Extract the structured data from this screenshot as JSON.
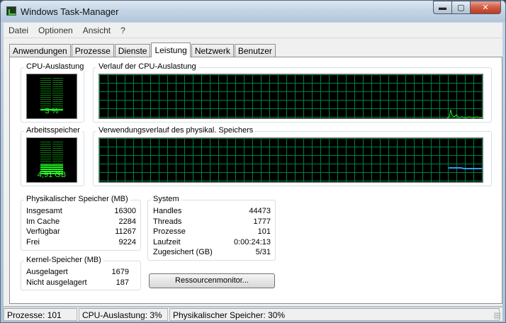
{
  "window": {
    "title": "Windows Task-Manager",
    "minimize_glyph": "▬",
    "maximize_glyph": "▢",
    "close_glyph": "✕"
  },
  "menu": [
    "Datei",
    "Optionen",
    "Ansicht",
    "?"
  ],
  "tabs": [
    {
      "label": "Anwendungen",
      "active": false
    },
    {
      "label": "Prozesse",
      "active": false
    },
    {
      "label": "Dienste",
      "active": false
    },
    {
      "label": "Leistung",
      "active": true
    },
    {
      "label": "Netzwerk",
      "active": false
    },
    {
      "label": "Benutzer",
      "active": false
    }
  ],
  "cpu_meter": {
    "label": "CPU-Auslastung",
    "value_text": "3 %",
    "level_percent": 3
  },
  "cpu_history": {
    "label": "Verlauf der CPU-Auslastung"
  },
  "memory_meter": {
    "label": "Arbeitsspeicher",
    "value_text": "4,91 GB",
    "level_percent": 30
  },
  "memory_history": {
    "label": "Verwendungsverlauf des physikal. Speichers"
  },
  "physical_memory": {
    "label": "Physikalischer Speicher (MB)",
    "rows": [
      {
        "name": "Insgesamt",
        "value": "16300"
      },
      {
        "name": "Im Cache",
        "value": "2284"
      },
      {
        "name": "Verfügbar",
        "value": "11267"
      },
      {
        "name": "Frei",
        "value": "9224"
      }
    ]
  },
  "kernel_memory": {
    "label": "Kernel-Speicher (MB)",
    "rows": [
      {
        "name": "Ausgelagert",
        "value": "1679"
      },
      {
        "name": "Nicht ausgelagert",
        "value": "187"
      }
    ]
  },
  "system": {
    "label": "System",
    "rows": [
      {
        "name": "Handles",
        "value": "44473"
      },
      {
        "name": "Threads",
        "value": "1777"
      },
      {
        "name": "Prozesse",
        "value": "101"
      },
      {
        "name": "Laufzeit",
        "value": "0:00:24:13"
      },
      {
        "name": "Zugesichert (GB)",
        "value": "5/31"
      }
    ]
  },
  "resource_monitor_button": "Ressourcenmonitor...",
  "status": {
    "processes": "Prozesse: 101",
    "cpu": "CPU-Auslastung: 3%",
    "memory": "Physikalischer Speicher: 30%"
  },
  "colors": {
    "graph_grid": "#008040",
    "cpu_line": "#22ff22",
    "memory_line": "#3399ff",
    "meter_text": "#2ef52e"
  }
}
